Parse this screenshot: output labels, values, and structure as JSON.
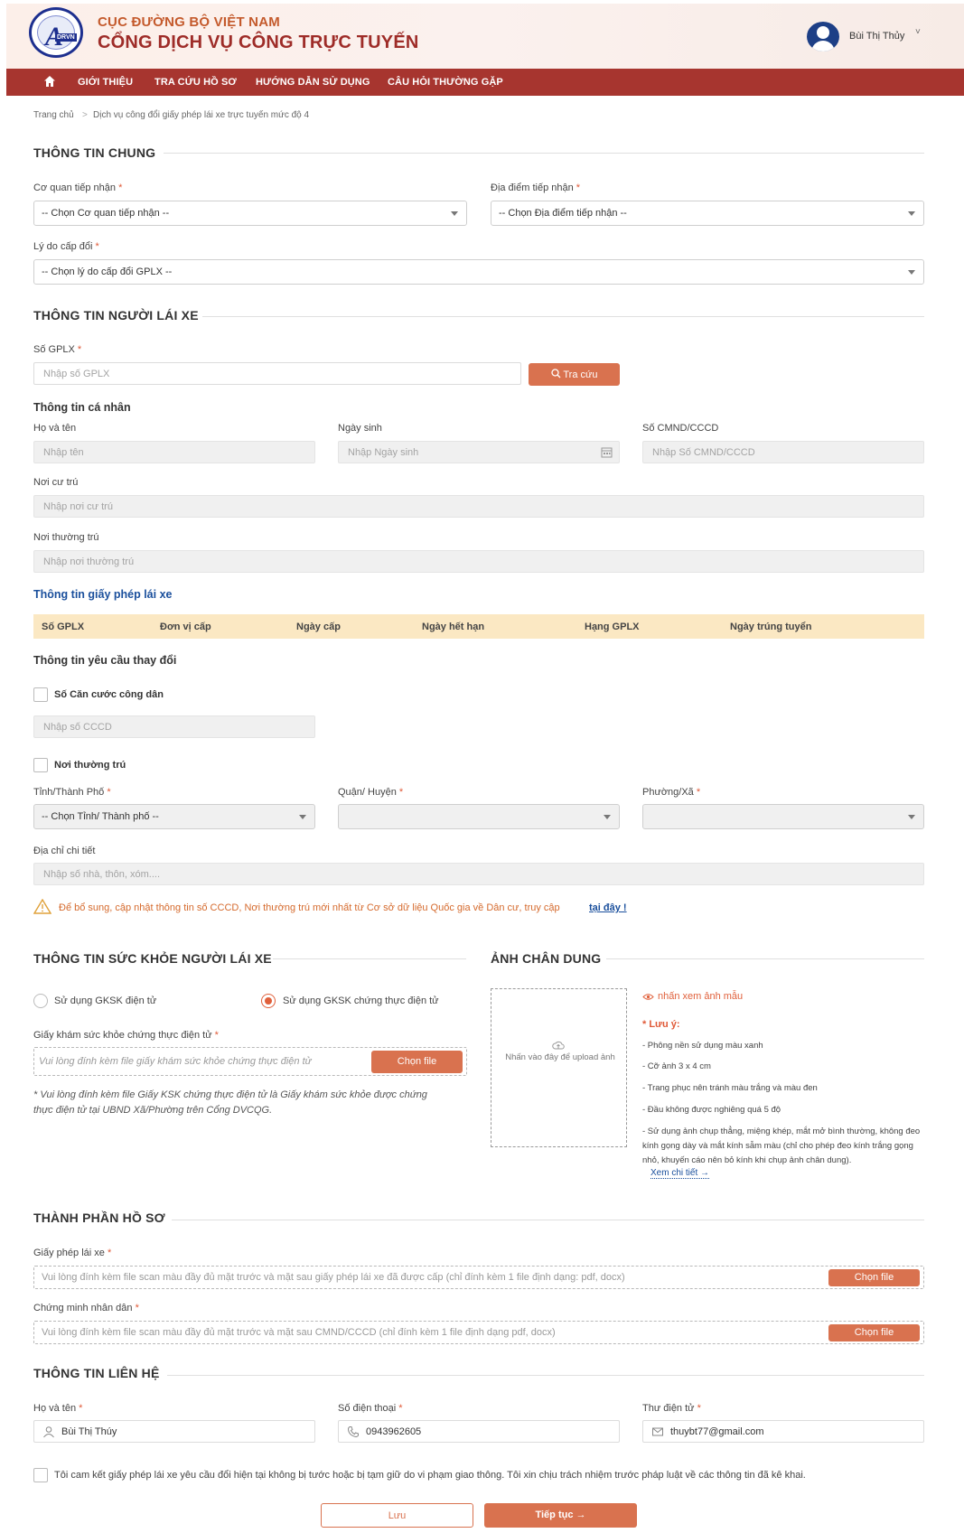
{
  "header": {
    "brand_line1": "CỤC ĐƯỜNG BỘ VIỆT NAM",
    "brand_line2": "CỔNG DỊCH VỤ CÔNG TRỰC TUYẾN",
    "logo_text": "DRVN",
    "user_name": "Bùi Thị Thủy",
    "user_caret": "˅"
  },
  "nav": {
    "items": [
      "GIỚI THIỆU",
      "TRA CỨU HỒ SƠ",
      "HƯỚNG DẪN SỬ DỤNG",
      "CÂU HỎI THƯỜNG GẶP"
    ]
  },
  "breadcrumb": {
    "home": "Trang chủ",
    "separator": ">",
    "current": "Dịch vụ công đổi giấy phép lái xe trực tuyến mức độ 4"
  },
  "general": {
    "title": "THÔNG TIN CHUNG",
    "agency_label": "Cơ quan tiếp nhận",
    "agency_value": "-- Chọn Cơ quan tiếp nhận --",
    "location_label": "Địa điểm tiếp nhận",
    "location_value": "-- Chọn Địa điểm tiếp nhận --",
    "reason_label": "Lý do cấp đổi",
    "reason_value": "-- Chọn lý do cấp đổi GPLX --",
    "required_mark": "*"
  },
  "driver": {
    "title": "THÔNG TIN NGƯỜI LÁI XE",
    "license_label": "Số GPLX",
    "license_placeholder": "Nhập số GPLX",
    "lookup_button": "Tra cứu",
    "personal_title": "Thông tin cá nhân",
    "name_label": "Họ và tên",
    "name_placeholder": "Nhập tên",
    "dob_label": "Ngày sinh",
    "dob_placeholder": "Nhập Ngày sinh",
    "id_label": "Số CMND/CCCD",
    "id_placeholder": "Nhập Số CMND/CCCD",
    "residence_label": "Nơi cư trú",
    "residence_placeholder": "Nhập nơi cư trú",
    "permanent_label": "Nơi thường trú",
    "permanent_placeholder": "Nhập nơi thường trú",
    "license_info_title": "Thông tin giấy phép lái xe",
    "table_headers": [
      "Số GPLX",
      "Đơn vị cấp",
      "Ngày cấp",
      "Ngày hết hạn",
      "Hạng GPLX",
      "Ngày trúng tuyển"
    ],
    "change_title": "Thông tin yêu cầu thay đổi",
    "cccd_checkbox": "Số Căn cước công dân",
    "cccd_placeholder": "Nhập số CCCD",
    "permanent_checkbox": "Nơi thường trú",
    "province_label": "Tỉnh/Thành Phố",
    "province_value": "-- Chọn Tỉnh/ Thành phố --",
    "district_label": "Quận/ Huyện",
    "ward_label": "Phường/Xã",
    "address_label": "Địa chỉ chi tiết",
    "address_placeholder": "Nhập số nhà, thôn, xóm....",
    "warning_text": "Để bổ sung, cập nhật thông tin số CCCD, Nơi thường trú mới nhất từ Cơ sở dữ liệu Quốc gia về Dân cư, truy cập",
    "warning_link": "tại đây !"
  },
  "health": {
    "title": "THÔNG TIN SỨC KHỎE NGƯỜI LÁI XE",
    "option1": "Sử dụng GKSK điện tử",
    "option2": "Sử dụng GKSK chứng thực điện tử",
    "cert_label": "Giấy khám sức khỏe chứng thực điện tử",
    "cert_placeholder": "Vui lòng đính kèm file giấy khám sức khỏe chứng thực điện tử",
    "choose_file": "Chọn file",
    "note_line1": "* Vui lòng đính kèm file Giấy KSK chứng thực điện tử là Giấy khám sức khỏe được chứng",
    "note_line2": "thực điện tử tại UBND Xã/Phường trên Cổng DVCQG."
  },
  "portrait": {
    "title": "ẢNH CHÂN DUNG",
    "upload_hint": "Nhấn vào đây để upload ảnh",
    "sample_link": "nhấn xem ảnh mẫu",
    "note_title": "* Lưu ý:",
    "notes": [
      "- Phông nền sử dụng màu xanh",
      "- Cỡ ảnh 3 x 4 cm",
      "- Trang phục nên tránh màu trắng và màu đen",
      "- Đầu không được nghiêng quá 5 độ",
      "- Sử dụng ảnh chụp thẳng, miệng khép, mắt mở bình thường, không đeo kính gọng dày và mắt kính sẫm màu (chỉ cho phép đeo kính trắng gọng nhỏ, khuyến cáo nên bỏ kính khi chụp ảnh chân dung)."
    ],
    "detail_link": "Xem chi tiết →"
  },
  "documents": {
    "title": "THÀNH PHẦN HỒ SƠ",
    "license_label": "Giấy phép lái xe",
    "license_placeholder": "Vui lòng đính kèm file scan màu đầy đủ mặt trước và mặt sau giấy phép lái xe đã được cấp (chỉ đính kèm 1 file định dạng: pdf, docx)",
    "id_label": "Chứng minh nhân dân",
    "id_placeholder": "Vui lòng đính kèm file scan màu đầy đủ mặt trước và mặt sau CMND/CCCD (chỉ đính kèm 1 file định dạng pdf, docx)",
    "choose_file": "Chọn file"
  },
  "contact": {
    "title": "THÔNG TIN LIÊN HỆ",
    "name_label": "Họ và tên",
    "name_value": "Bùi Thị Thúy",
    "phone_label": "Số điện thoại",
    "phone_value": "0943962605",
    "email_label": "Thư điện tử",
    "email_value": "thuybt77@gmail.com"
  },
  "commitment": "Tôi cam kết giấy phép lái xe yêu cầu đổi hiện tại không bị tước hoặc bị tạm giữ do vi phạm giao thông. Tôi xin chịu trách nhiệm trước pháp luật về các thông tin đã kê khai.",
  "actions": {
    "save": "Lưu",
    "next": "Tiếp tục →"
  },
  "colors": {
    "brand_red": "#a7352f",
    "accent_orange": "#d9724f",
    "table_header": "#fbe8c3",
    "link_blue": "#1a4f9c"
  }
}
